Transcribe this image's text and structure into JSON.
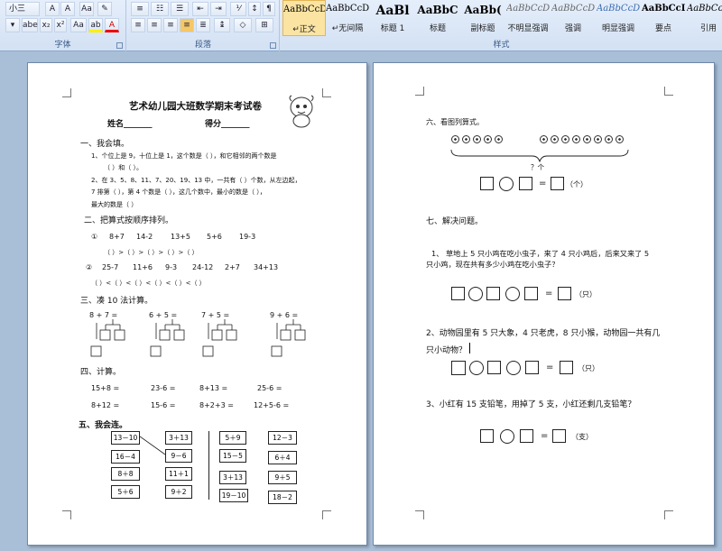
{
  "ribbon": {
    "font_size": "小三",
    "groups": {
      "font": "字体",
      "paragraph": "段落",
      "styles": "样式"
    },
    "styles": [
      {
        "sample": "AaBbCcDc",
        "name": "↵正文",
        "selected": true
      },
      {
        "sample": "AaBbCcDc",
        "name": "↵无间隔"
      },
      {
        "sample": "AaBl",
        "name": "标题 1"
      },
      {
        "sample": "AaBbC",
        "name": "标题"
      },
      {
        "sample": "AaBb(",
        "name": "副标题"
      },
      {
        "sample": "AaBbCcDc",
        "name": "不明显强调"
      },
      {
        "sample": "AaBbCcDc",
        "name": "强调"
      },
      {
        "sample": "AaBbCcDc",
        "name": "明显强调"
      },
      {
        "sample": "AaBbCcD",
        "name": "要点"
      },
      {
        "sample": "AaBbCcDc",
        "name": "引用"
      }
    ]
  },
  "page1": {
    "title": "艺术幼儿园大班数学期末考试卷",
    "name_label": "姓名_______",
    "score_label": "得分_______",
    "s1_heading": "一、我会填。",
    "s1_l1": "1、个位上是 9，十位上是 1，这个数是（        ），和它相邻的两个数是",
    "s1_l2": "（        ）和（        ）。",
    "s1_l3": "2、在 3、5、8、11、7、20、19、13 中，一共有（        ）个数，从左边起，",
    "s1_l4": "7 排第（        ），第 4 个数是（        ），这几个数中，最小的数是（        ），",
    "s1_l5": "最大的数是（        ）",
    "s2_heading": "二、把算式按顺序排列。",
    "s2_row1": [
      "①",
      "8+7",
      "14-2",
      "13+5",
      "5+6",
      "19-3"
    ],
    "s2_row1_blanks": "（        ）>（        ）>（        ）>（        ）>（        ）",
    "s2_row2": [
      "②",
      "25-7",
      "11+6",
      "9-3",
      "24-12",
      "2+7",
      "34+13"
    ],
    "s2_row2_blanks": "（        ）<（        ）<（        ）<（        ）<（        ）<（        ）",
    "s3_heading": "三、凑 10 法计算。",
    "s3_items": [
      "8  +  7  =",
      "6  +  5  =",
      "7  +  5  =",
      "9  +  6  ="
    ],
    "s4_heading": "四、计算。",
    "s4_row1": [
      "15+8 =",
      "23-6 =",
      "8+13 =",
      "25-6 ="
    ],
    "s4_row2": [
      "8+12 =",
      "15-6 =",
      "8+2+3 =",
      "12+5-6 ="
    ],
    "s5_heading": "五、我会连。",
    "s5_col1": [
      "13－10",
      "16－4",
      "8＋8",
      "5＋6"
    ],
    "s5_col2": [
      "3＋13",
      "9－6",
      "11＋1",
      "9＋2"
    ],
    "s5_col3": [
      "5＋9",
      "15－5",
      "3＋13",
      "19－10"
    ],
    "s5_col4": [
      "12－3",
      "6＋4",
      "9＋5",
      "18－2"
    ]
  },
  "page2": {
    "s6_heading": "六、看图列算式。",
    "brace_label": "？个",
    "unit_ge": "（个）",
    "s7_heading": "七、解决问题。",
    "q1_l1": "1、 草地上 5 只小鸡在吃小虫子，来了 4 只小鸡后，后来又来了 5",
    "q1_l2": "只小鸡，现在共有多少小鸡在吃小虫子？",
    "unit_zhi": "（只）",
    "q2_l1": "2、动物园里有 5 只大象，4 只老虎，8 只小猴，动物园一共有几",
    "q2_l2": "只小动物？",
    "q3_l1": "3、小红有 15 支铅笔，用掉了 5 支，小红还剩几支铅笔？",
    "unit_zhi2": "（支）",
    "equals": "="
  }
}
